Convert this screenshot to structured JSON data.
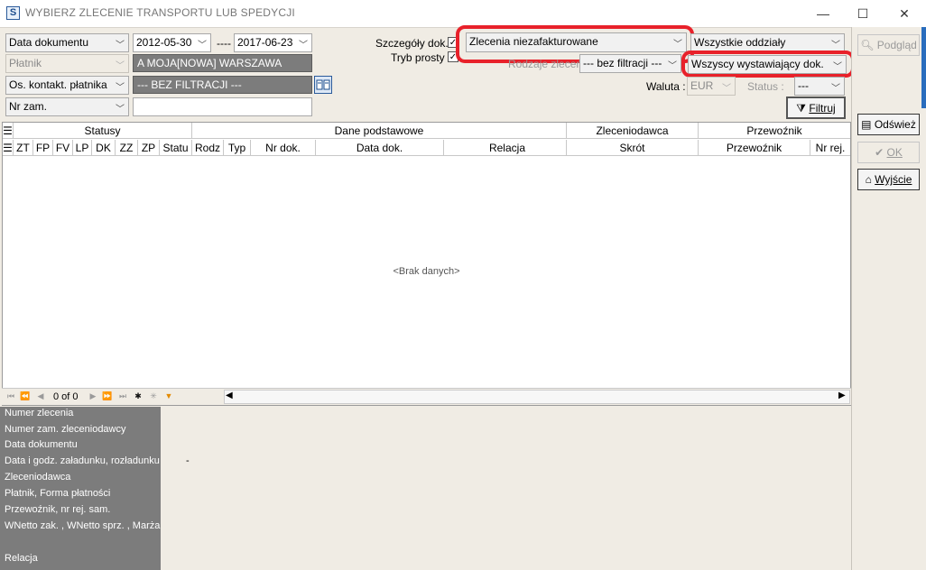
{
  "window": {
    "title": "WYBIERZ ZLECENIE TRANSPORTU LUB SPEDYCJI",
    "app_icon_letter": "S",
    "minimize_symbol": "—",
    "maximize_symbol": "☐",
    "close_symbol": "✕"
  },
  "filters": {
    "date_type": "Data dokumentu",
    "date_from": "2012-05-30",
    "date_separator": "----",
    "date_to": "2017-06-23",
    "payer_label": "Płatnik",
    "payer_value": "A MOJA[NOWA] WARSZAWA",
    "contact_label": "Os. kontakt. płatnika",
    "contact_value": "--- BEZ FILTRACJI ---",
    "order_no_label": "Nr zam.",
    "order_no_value": "",
    "details_label": "Szczegóły dok.",
    "details_checked": "✓",
    "simple_mode_label": "Tryb prosty",
    "simple_mode_checked": "✓",
    "order_status_value": "Zlecenia niezafakturowane",
    "order_kinds_label": "Rodzaje zleceń",
    "order_kinds_value": "--- bez filtracji ---",
    "branches_value": "Wszystkie oddziały",
    "issuers_value": "Wszyscy wystawiający dok.",
    "currency_label": "Waluta :",
    "currency_value": "EUR",
    "status_label": "Status :",
    "status_value": "---",
    "filter_button": "Filtruj"
  },
  "buttons": {
    "preview": "Podgląd",
    "refresh": "Odśwież",
    "ok": "OK",
    "exit": "Wyjście"
  },
  "grid": {
    "group_headers": [
      "Statusy",
      "Dane podstawowe",
      "Zleceniodawca",
      "Przewoźnik"
    ],
    "columns": [
      "ZT",
      "FP",
      "FV",
      "LP",
      "DK",
      "ZZ",
      "ZP",
      "Statu",
      "Rodz",
      "Typ",
      "Nr dok.",
      "Data dok.",
      "Relacja",
      "Skrót",
      "Przewoźnik",
      "Nr rej."
    ],
    "empty_text": "<Brak danych>",
    "pager_text": "0 of 0"
  },
  "details": {
    "labels": [
      "Numer zlecenia",
      "Numer zam. zleceniodawcy",
      "Data dokumentu",
      "Data i godz. załadunku, rozładunku",
      "Zleceniodawca",
      "Płatnik, Forma płatności",
      "Przewoźnik, nr rej. sam.",
      "WNetto zak. , WNetto sprz. , Marża",
      "Relacja"
    ],
    "loading_value": "-"
  },
  "colors": {
    "highlight": "#e8212a",
    "panel_bg": "#f0ece4",
    "detail_bg": "#7c7c7c"
  }
}
